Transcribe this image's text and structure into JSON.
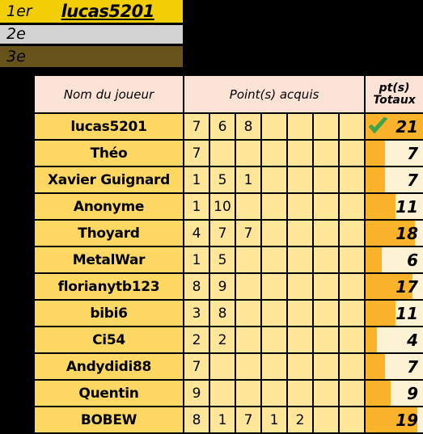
{
  "podium": {
    "rows": [
      {
        "rank": "1er",
        "name": "lucas5201",
        "color": "#F2CE07"
      },
      {
        "rank": "2e",
        "name": "",
        "color": "#D2D2D2"
      },
      {
        "rank": "3e",
        "name": "",
        "color": "#68521C"
      }
    ]
  },
  "table": {
    "headers": {
      "name": "Nom du joueur",
      "points": "Point(s) acquis",
      "total_line1": "pt(s)",
      "total_line2": "Totaux"
    },
    "point_columns": 7,
    "max_total": 21,
    "colors": {
      "header_bg": "#FCE3D5",
      "name_bg": "#FFD864",
      "point_bg": "#FFE699",
      "total_bg": "#FDF2D3",
      "bar_fill": "#FCB32C",
      "check": "#3FA34A",
      "border": "#000000"
    },
    "rows": [
      {
        "name": "lucas5201",
        "points": [
          "7",
          "6",
          "8",
          "",
          "",
          "",
          ""
        ],
        "total": 21,
        "leader": true
      },
      {
        "name": "Théo",
        "points": [
          "7",
          "",
          "",
          "",
          "",
          "",
          ""
        ],
        "total": 7,
        "leader": false
      },
      {
        "name": "Xavier Guignard",
        "points": [
          "1",
          "5",
          "1",
          "",
          "",
          "",
          ""
        ],
        "total": 7,
        "leader": false
      },
      {
        "name": "Anonyme",
        "points": [
          "1",
          "10",
          "",
          "",
          "",
          "",
          ""
        ],
        "total": 11,
        "leader": false
      },
      {
        "name": "Thoyard",
        "points": [
          "4",
          "7",
          "7",
          "",
          "",
          "",
          ""
        ],
        "total": 18,
        "leader": false
      },
      {
        "name": "MetalWar",
        "points": [
          "1",
          "5",
          "",
          "",
          "",
          "",
          ""
        ],
        "total": 6,
        "leader": false
      },
      {
        "name": "florianytb123",
        "points": [
          "8",
          "9",
          "",
          "",
          "",
          "",
          ""
        ],
        "total": 17,
        "leader": false
      },
      {
        "name": "bibi6",
        "points": [
          "3",
          "8",
          "",
          "",
          "",
          "",
          ""
        ],
        "total": 11,
        "leader": false
      },
      {
        "name": "Ci54",
        "points": [
          "2",
          "2",
          "",
          "",
          "",
          "",
          ""
        ],
        "total": 4,
        "leader": false
      },
      {
        "name": "Andydidi88",
        "points": [
          "7",
          "",
          "",
          "",
          "",
          "",
          ""
        ],
        "total": 7,
        "leader": false
      },
      {
        "name": "Quentin",
        "points": [
          "9",
          "",
          "",
          "",
          "",
          "",
          ""
        ],
        "total": 9,
        "leader": false
      },
      {
        "name": "BOBEW",
        "points": [
          "8",
          "1",
          "7",
          "1",
          "2",
          "",
          ""
        ],
        "total": 19,
        "leader": false
      }
    ]
  },
  "icons": {
    "check": "check-icon"
  }
}
